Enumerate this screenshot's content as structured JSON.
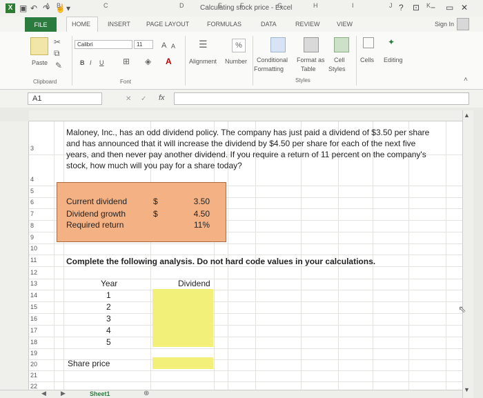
{
  "window": {
    "title": "Calculating stock price - Excel",
    "help": "?",
    "minimize": "−",
    "restore": "▭",
    "close": "✕",
    "sign_in": "Sign In"
  },
  "tabs": [
    "FILE",
    "HOME",
    "INSERT",
    "PAGE LAYOUT",
    "FORMULAS",
    "DATA",
    "REVIEW",
    "VIEW"
  ],
  "ribbon": {
    "clipboard": {
      "paste": "Paste",
      "group": "Clipboard"
    },
    "font": {
      "name": "Calibri",
      "size": "11",
      "grow": "A",
      "shrink": "A",
      "bold": "B",
      "italic": "I",
      "underline": "U",
      "group": "Font"
    },
    "alignment": "Alignment",
    "number": "Number",
    "number_icon": "%",
    "styles": {
      "conditional": "Conditional",
      "formatting": "Formatting",
      "format_as": "Format as",
      "table": "Table",
      "cell": "Cell",
      "cell_styles": "Styles",
      "group": "Styles"
    },
    "cells": "Cells",
    "editing": "Editing"
  },
  "formula_bar": {
    "name_box": "A1",
    "fx": "fx",
    "cancel": "✕",
    "enter": "✓",
    "value": ""
  },
  "columns": [
    "A",
    "B",
    "C",
    "D",
    "E",
    "F",
    "G",
    "H",
    "I",
    "J",
    "K"
  ],
  "rows": [
    "3",
    "4",
    "5",
    "6",
    "7",
    "8",
    "9",
    "10",
    "11",
    "12",
    "13",
    "14",
    "15",
    "16",
    "17",
    "18",
    "19",
    "20",
    "21",
    "22"
  ],
  "sheet": {
    "question": "Maloney, Inc., has an odd dividend policy. The company has just paid a dividend of $3.50 per share and has announced that it will increase the dividend by $4.50 per share for each of the next five years, and then never pay another dividend. If you require a return of 11 percent on the company's stock, how much will you pay for a share today?",
    "inputs": [
      {
        "label": "Current dividend",
        "symbol": "$",
        "value": "3.50"
      },
      {
        "label": "Dividend growth",
        "symbol": "$",
        "value": "4.50"
      },
      {
        "label": "Required return",
        "symbol": "",
        "value": "11%"
      }
    ],
    "instruction": "Complete the following analysis. Do not hard code values in your calculations.",
    "year_header": "Year",
    "dividend_header": "Dividend",
    "years": [
      "1",
      "2",
      "3",
      "4",
      "5"
    ],
    "share_price_label": "Share price",
    "highlight_color": "#f3f07a",
    "input_box_color": "#f4b183"
  },
  "sheet_tabs": {
    "active": "Sheet1",
    "add": "⊕"
  }
}
